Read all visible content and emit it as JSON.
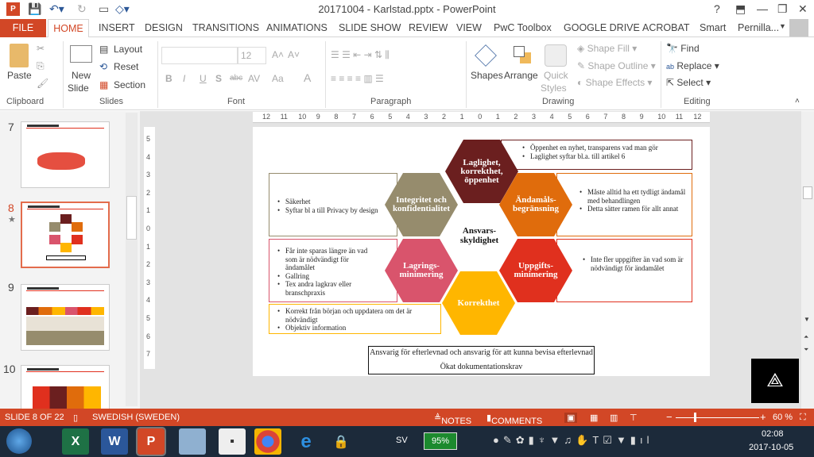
{
  "window": {
    "title": "20171004 - Karlstad.pptx - PowerPoint",
    "help": "?",
    "minimize": "—",
    "restore": "❐",
    "close": "✕"
  },
  "tabs": [
    "FILE",
    "HOME",
    "INSERT",
    "DESIGN",
    "TRANSITIONS",
    "ANIMATIONS",
    "SLIDE SHOW",
    "REVIEW",
    "VIEW",
    "PwC Toolbox",
    "GOOGLE DRIVE",
    "ACROBAT",
    "Smart"
  ],
  "user": "Pernilla...",
  "ribbon": {
    "clipboard": {
      "paste": "Paste",
      "label": "Clipboard"
    },
    "slides": {
      "new_slide": "New",
      "new_slide2": "Slide",
      "layout": "Layout",
      "reset": "Reset",
      "section": "Section",
      "label": "Slides"
    },
    "font": {
      "size": "12",
      "label": "Font",
      "bold": "B",
      "italic": "I",
      "underline": "U",
      "shadow": "S",
      "strike": "abc",
      "spacing": "AV",
      "case": "Aa",
      "color": "A"
    },
    "paragraph": {
      "label": "Paragraph"
    },
    "drawing": {
      "shapes": "Shapes",
      "arrange": "Arrange",
      "quick": "Quick",
      "styles": "Styles",
      "fill": "Shape Fill",
      "outline": "Shape Outline",
      "effects": "Shape Effects",
      "label": "Drawing"
    },
    "editing": {
      "find": "Find",
      "replace": "Replace",
      "select": "Select",
      "label": "Editing"
    }
  },
  "thumbnails": [
    {
      "num": "7"
    },
    {
      "num": "8",
      "selected": true
    },
    {
      "num": "9"
    },
    {
      "num": "10"
    }
  ],
  "ruler_h": [
    "12",
    "11",
    "10",
    "9",
    "8",
    "7",
    "6",
    "5",
    "4",
    "3",
    "2",
    "1",
    "0",
    "1",
    "2",
    "3",
    "4",
    "5",
    "6",
    "7",
    "8",
    "9",
    "10",
    "11",
    "12"
  ],
  "ruler_v": [
    "5",
    "4",
    "3",
    "2",
    "1",
    "0",
    "1",
    "2",
    "3",
    "4",
    "5",
    "6",
    "7"
  ],
  "slide": {
    "center": "Ansvars-\nskyldighet",
    "hexes": [
      {
        "label": "Laglighet, korrekthet, öppenhet",
        "color": "#6b1f1f"
      },
      {
        "label": "Integritet och konfidentialitet",
        "color": "#968c6d"
      },
      {
        "label": "Ändamåls-begränsning",
        "color": "#e06c0c"
      },
      {
        "label": "Lagrings-minimering",
        "color": "#d9546c"
      },
      {
        "label": "Uppgifts-minimering",
        "color": "#e0301e"
      },
      {
        "label": "Korrekthet",
        "color": "#ffb600"
      }
    ],
    "boxes": {
      "laglighet": [
        "Öppenhet en nyhet, transparens vad man gör",
        "Laglighet syftar bl.a. till artikel 6"
      ],
      "integritet": [
        "Säkerhet",
        "Syftar bl a till Privacy by design"
      ],
      "andamal": [
        "Måste alltid ha ett tydligt ändamål med behandlingen",
        "Detta sätter ramen för allt annat"
      ],
      "lagring": [
        "Får inte sparas längre än vad som är nödvändigt för ändamålet",
        "Gallring",
        "Tex andra lagkrav eller branschpraxis"
      ],
      "uppgift": [
        "Inte fler uppgifter än vad som är nödvändigt för ändamålet"
      ],
      "korrekthet": [
        "Korrekt från början och uppdatera om det är nödvändigt",
        "Objektiv information"
      ]
    },
    "bottom_line1": "Ansvarig för efterlevnad och ansvarig för att kunna bevisa efterlevnad",
    "bottom_line2": "Ökat dokumentationskrav"
  },
  "status": {
    "slide": "SLIDE 8 OF 22",
    "language": "SWEDISH (SWEDEN)",
    "notes": "NOTES",
    "comments": "COMMENTS",
    "zoom": "60 %",
    "zoom_percent": 60
  },
  "taskbar": {
    "lang": "SV",
    "battery": "95%",
    "time": "02:08",
    "date": "2017-10-05"
  }
}
